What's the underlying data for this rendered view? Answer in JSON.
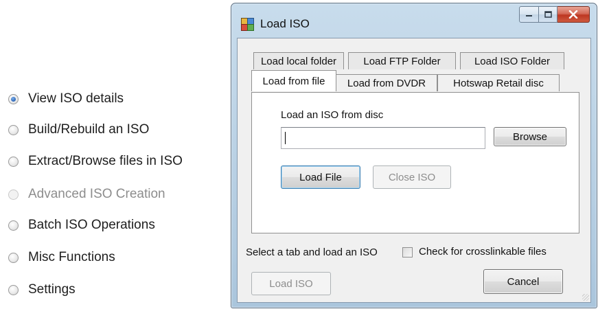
{
  "options": [
    {
      "label": "View ISO details",
      "checked": true,
      "enabled": true
    },
    {
      "label": "Build/Rebuild an ISO",
      "checked": false,
      "enabled": true
    },
    {
      "label": "Extract/Browse files in ISO",
      "checked": false,
      "enabled": true
    },
    {
      "label": "Advanced ISO Creation",
      "checked": false,
      "enabled": false
    },
    {
      "label": "Batch ISO Operations",
      "checked": false,
      "enabled": true
    },
    {
      "label": "Misc Functions",
      "checked": false,
      "enabled": true
    },
    {
      "label": "Settings",
      "checked": false,
      "enabled": true
    }
  ],
  "dialog": {
    "title": "Load ISO",
    "tabs_row_back": [
      "Load local folder",
      "Load FTP Folder",
      "Load ISO Folder"
    ],
    "tabs_row_front": [
      "Load from file",
      "Load from DVDR",
      "Hotswap Retail disc"
    ],
    "active_tab": "Load from file",
    "page": {
      "label": "Load an ISO from disc",
      "input_value": "",
      "browse_label": "Browse",
      "load_file_label": "Load File",
      "close_iso_label": "Close ISO"
    },
    "status_text": "Select a tab and load an ISO",
    "checkbox_label": "Check for crosslinkable files",
    "checkbox_checked": false,
    "load_iso_label": "Load ISO",
    "cancel_label": "Cancel"
  },
  "colors": {
    "radio_selected": "#2a64b6",
    "window_frame": "#b7cfe3",
    "close_button": "#c8452f"
  }
}
